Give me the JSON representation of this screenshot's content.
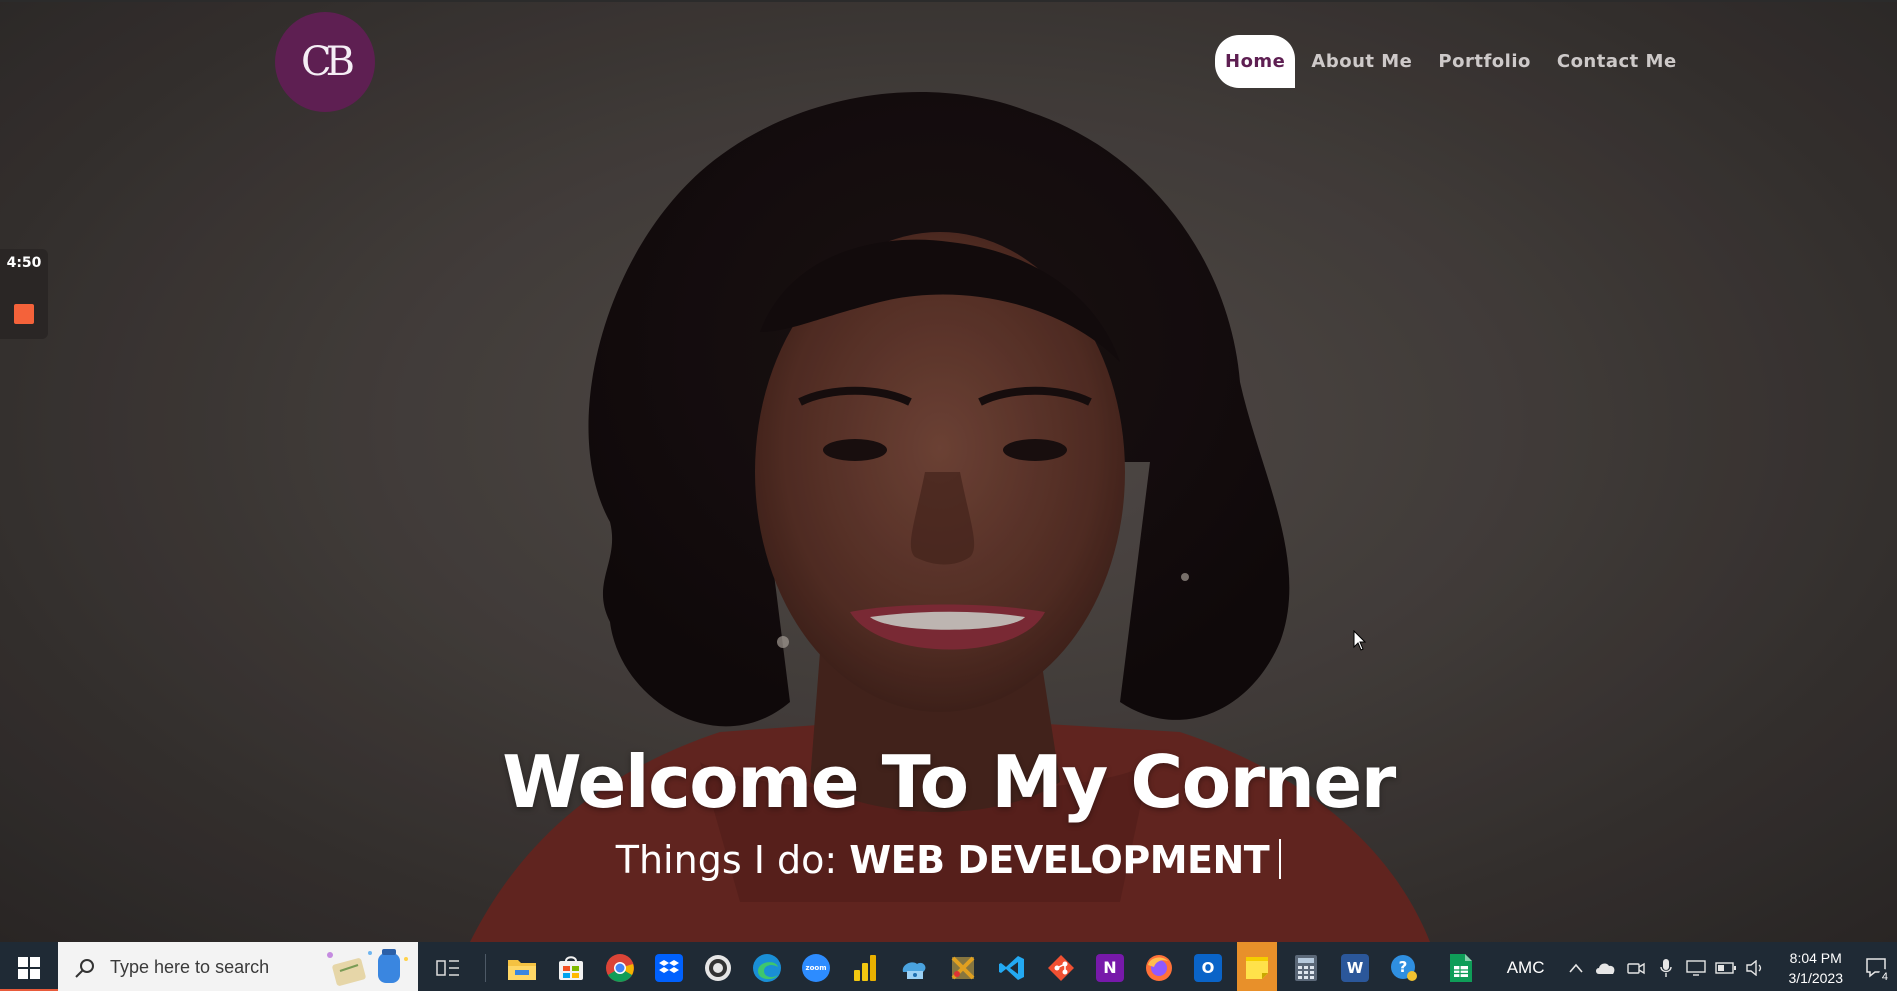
{
  "site": {
    "logo_text": "CB",
    "nav": [
      {
        "label": "Home",
        "active": true
      },
      {
        "label": "About Me",
        "active": false
      },
      {
        "label": "Portfolio",
        "active": false
      },
      {
        "label": "Contact Me",
        "active": false
      }
    ],
    "headline": "Welcome To My Corner",
    "tagline_prefix": "Things I do:",
    "tagline_highlight": "WEB DEVELOPMENT",
    "colors": {
      "brand": "#5e1f52",
      "stop": "#f4623a"
    }
  },
  "recorder": {
    "elapsed": "4:50"
  },
  "taskbar": {
    "search_placeholder": "Type here to search",
    "pinned": [
      "file-explorer-icon",
      "microsoft-store-icon",
      "chrome-icon",
      "dropbox-icon",
      "github-desktop-icon",
      "edge-icon",
      "zoom-icon",
      "power-bi-icon",
      "azure-data-studio-icon",
      "snipping-tool-icon",
      "vscode-icon",
      "git-icon",
      "onenote-icon",
      "firefox-icon",
      "outlook-icon",
      "sticky-notes-icon",
      "calculator-icon",
      "word-icon",
      "get-help-icon",
      "sheets-icon"
    ],
    "zoom_label": "zoom",
    "onenote_label": "N",
    "outlook_label": "O",
    "word_label": "W",
    "tray_label": "AMC",
    "time": "8:04 PM",
    "date": "3/1/2023",
    "notification_count": "4"
  }
}
